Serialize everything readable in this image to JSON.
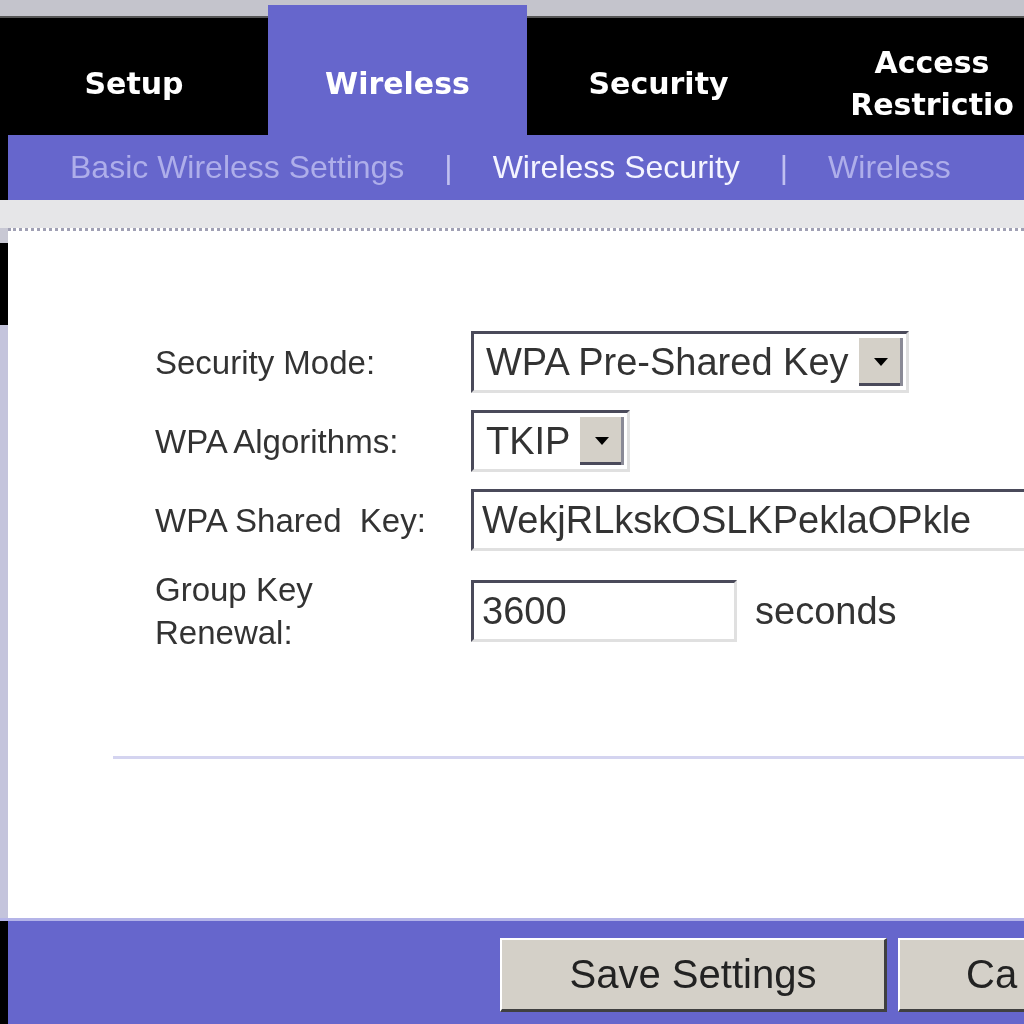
{
  "tabs": [
    {
      "label": "Setup",
      "selected": false
    },
    {
      "label": "Wireless",
      "selected": true
    },
    {
      "label": "Security",
      "selected": false
    },
    {
      "label": "Access Restrictio",
      "selected": false
    }
  ],
  "subnav": [
    {
      "kind": "link",
      "label": "Basic Wireless Settings",
      "selected": false
    },
    {
      "kind": "separator",
      "label": "|"
    },
    {
      "kind": "link",
      "label": "Wireless Security",
      "selected": true
    },
    {
      "kind": "separator",
      "label": "|"
    },
    {
      "kind": "link",
      "label": "Wireless",
      "selected": false
    }
  ],
  "form": {
    "fields": [
      {
        "kind": "select",
        "label": "Security Mode:",
        "value": "WPA Pre-Shared Key"
      },
      {
        "kind": "select",
        "label": "WPA Algorithms:",
        "value": "TKIP"
      },
      {
        "kind": "text",
        "label": "WPA Shared  Key:",
        "value": "WekjRLkskOSLKPeklaOPkle"
      },
      {
        "kind": "text",
        "label": "Group Key\nRenewal:",
        "value": "3600",
        "unit": "seconds"
      }
    ]
  },
  "buttons": [
    {
      "label": "Save Settings"
    },
    {
      "label": "Ca"
    }
  ]
}
